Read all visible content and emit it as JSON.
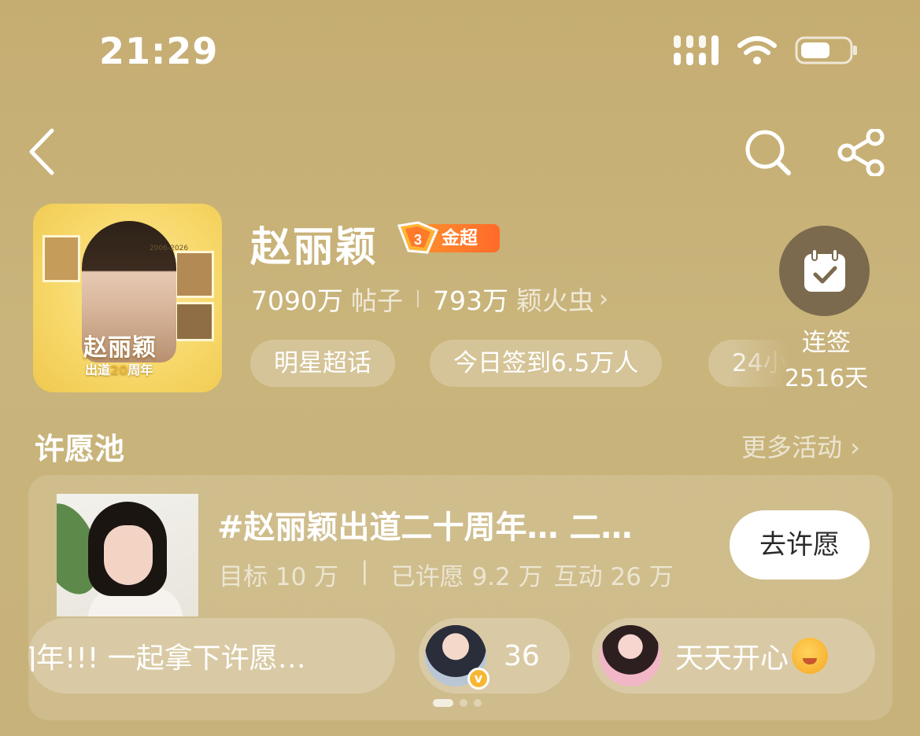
{
  "status_bar": {
    "time": "21:29"
  },
  "header": {
    "star_name": "赵丽颖",
    "level_badge": "金超",
    "cover": {
      "title": "赵丽颖",
      "subtitle_prefix": "出道",
      "subtitle_highlight": "20",
      "subtitle_suffix": "周年",
      "years": "2006-2026"
    },
    "stats": {
      "posts_value": "7090万",
      "posts_label": "帖子",
      "fans_value": "793万",
      "fans_label": "颖火虫",
      "chevron": "›"
    },
    "tags": [
      "明星超话",
      "今日签到6.5万人",
      "24小"
    ],
    "checkin": {
      "label": "连签",
      "days": "2516天"
    }
  },
  "wish_pool": {
    "title": "许愿池",
    "more": "更多活动 ›",
    "card": {
      "title": "#赵丽颖出道二十周年… 二…",
      "target": "目标 10 万",
      "separator": "|",
      "wished": "已许愿 9.2 万",
      "interactions": "互动 26 万",
      "button": "去许愿"
    },
    "bubbles": [
      {
        "text": "]年!!! 一起拿下许愿…"
      },
      {
        "count": "36",
        "verified": "v"
      },
      {
        "text": "天天开心"
      }
    ],
    "pagination": {
      "active_index": 0,
      "total": 3
    }
  },
  "colors": {
    "background": "#c8b37c",
    "badge": "#ff7a2b",
    "checkin": "#7c6a4e"
  },
  "icons": [
    "back-icon",
    "search-icon",
    "share-icon",
    "signal-icon",
    "wifi-icon",
    "battery-icon",
    "calendar-check-icon"
  ]
}
